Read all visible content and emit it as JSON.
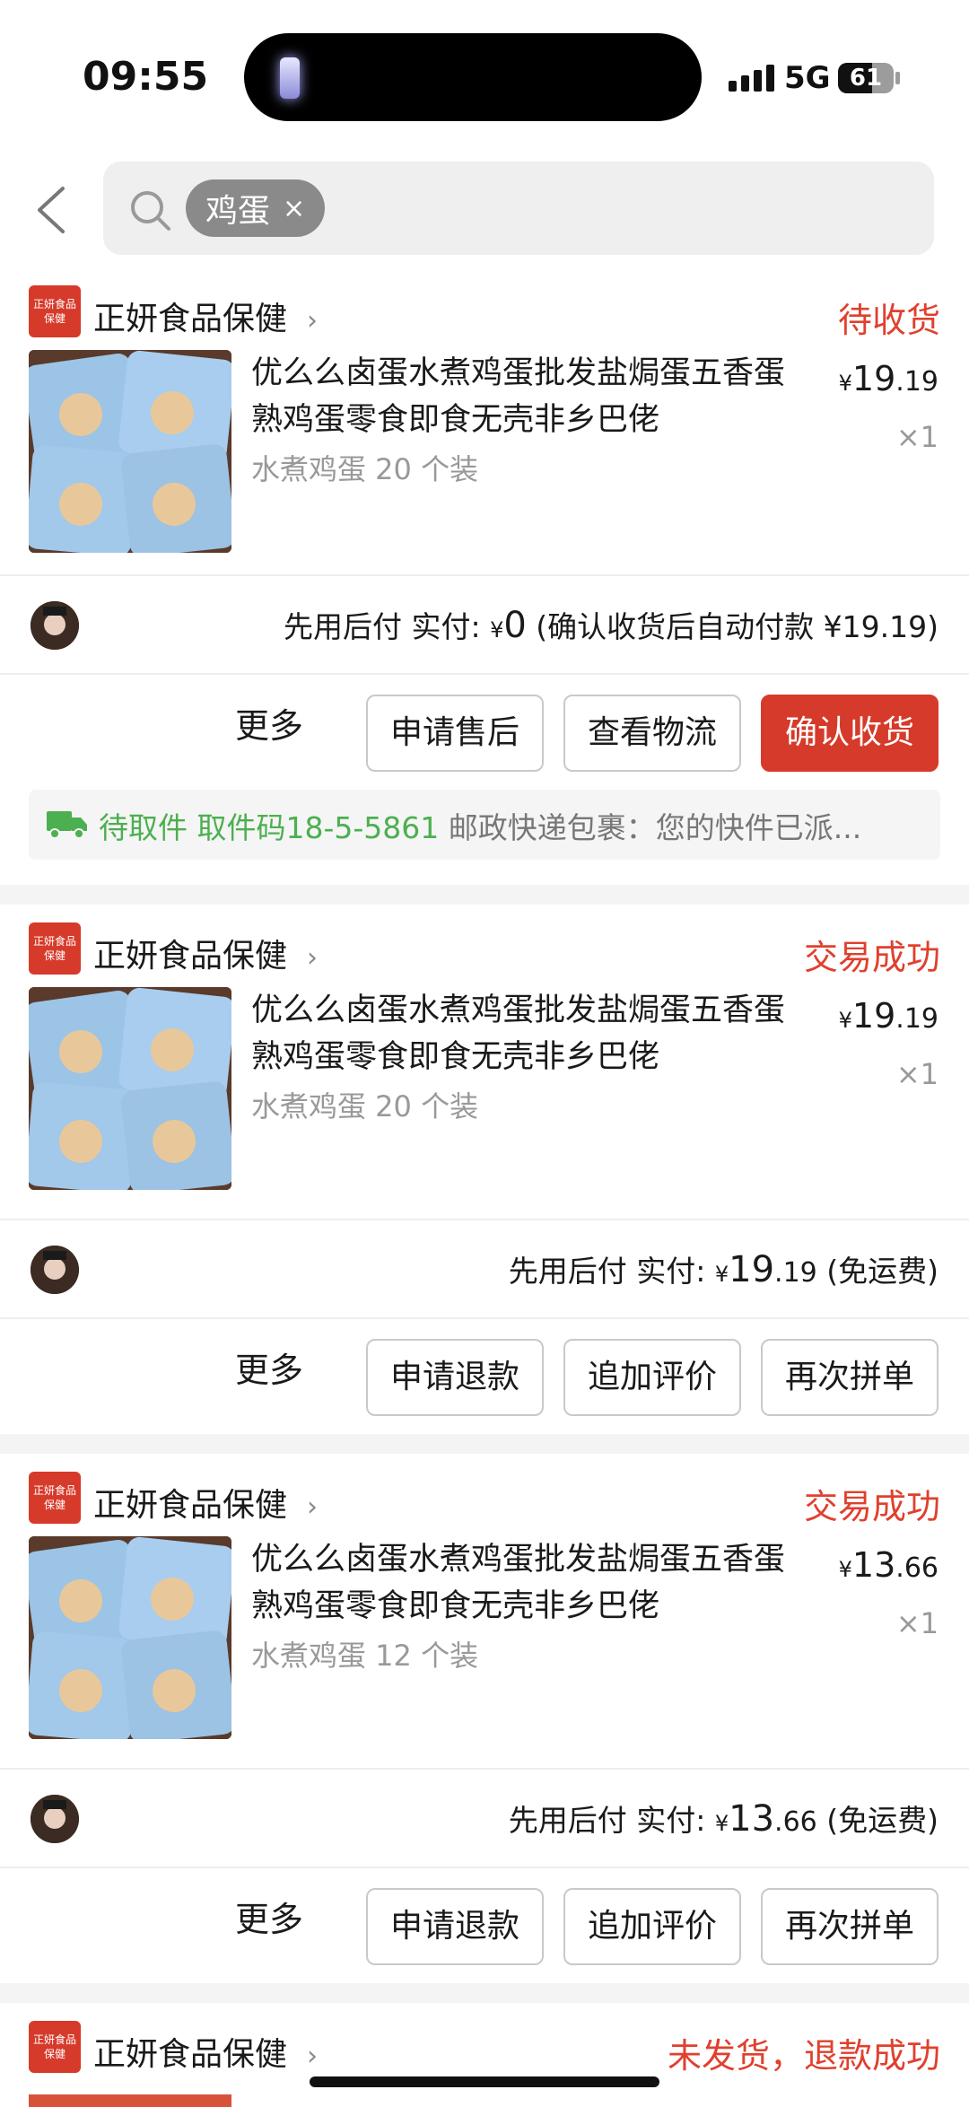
{
  "status_bar": {
    "time": "09:55",
    "network": "5G",
    "battery": "61",
    "battery_level": 0.61
  },
  "search": {
    "chip_label": "鸡蛋",
    "chip_clear": "×"
  },
  "colors": {
    "accent": "#d63a2a",
    "status_red": "#e0402e",
    "logistics_green": "#4caf50"
  },
  "orders": [
    {
      "shop": "正妍食品保健",
      "shop_logo": "正妍食品保健",
      "status": "待收货",
      "title": "优么么卤蛋水煮鸡蛋批发盐焗蛋五香蛋熟鸡蛋零食即食无壳非乡巴佬",
      "spec": "水煮鸡蛋 20 个装",
      "price_cur": "¥",
      "price_int": "19",
      "price_dec": ".19",
      "qty": "×1",
      "pay_prefix": "先用后付  实付: ",
      "pay_cur": "¥",
      "pay_int": "0",
      "pay_dec": "",
      "pay_suffix": " (确认收货后自动付款 ¥19.19)",
      "more": "更多",
      "buttons": [
        "申请售后",
        "查看物流",
        "确认收货"
      ],
      "logistics_status": "待取件 取件码18-5-5861",
      "logistics_detail": " 邮政快递包裹：您的快件已派..."
    },
    {
      "shop": "正妍食品保健",
      "shop_logo": "正妍食品保健",
      "status": "交易成功",
      "title": "优么么卤蛋水煮鸡蛋批发盐焗蛋五香蛋熟鸡蛋零食即食无壳非乡巴佬",
      "spec": "水煮鸡蛋 20 个装",
      "price_cur": "¥",
      "price_int": "19",
      "price_dec": ".19",
      "qty": "×1",
      "pay_prefix": "先用后付  实付: ",
      "pay_cur": "¥",
      "pay_int": "19",
      "pay_dec": ".19",
      "pay_suffix": " (免运费)",
      "more": "更多",
      "buttons": [
        "申请退款",
        "追加评价",
        "再次拼单"
      ]
    },
    {
      "shop": "正妍食品保健",
      "shop_logo": "正妍食品保健",
      "status": "交易成功",
      "title": "优么么卤蛋水煮鸡蛋批发盐焗蛋五香蛋熟鸡蛋零食即食无壳非乡巴佬",
      "spec": "水煮鸡蛋 12 个装",
      "price_cur": "¥",
      "price_int": "13",
      "price_dec": ".66",
      "qty": "×1",
      "pay_prefix": "先用后付  实付: ",
      "pay_cur": "¥",
      "pay_int": "13",
      "pay_dec": ".66",
      "pay_suffix": " (免运费)",
      "more": "更多",
      "buttons": [
        "申请退款",
        "追加评价",
        "再次拼单"
      ]
    },
    {
      "shop": "正妍食品保健",
      "shop_logo": "正妍食品保健",
      "status": "未发货，退款成功"
    }
  ]
}
